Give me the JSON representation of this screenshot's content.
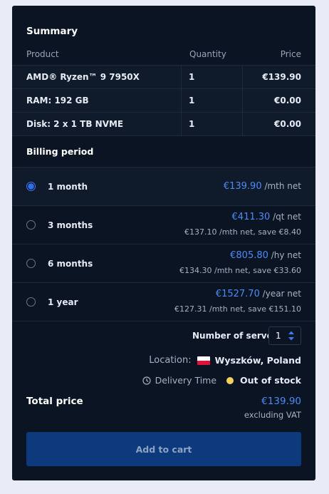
{
  "summary": {
    "title": "Summary",
    "headers": {
      "product": "Product",
      "quantity": "Quantity",
      "price": "Price"
    },
    "rows": [
      {
        "product": "AMD® Ryzen™ 9 7950X",
        "quantity": "1",
        "price": "€139.90"
      },
      {
        "product": "RAM: 192 GB",
        "quantity": "1",
        "price": "€0.00"
      },
      {
        "product": "Disk: 2 x 1 TB NVME",
        "quantity": "1",
        "price": "€0.00"
      }
    ]
  },
  "billing": {
    "title": "Billing period",
    "options": [
      {
        "label": "1 month",
        "price": "€139.90",
        "unit": "/mth net",
        "sub": "",
        "selected": true
      },
      {
        "label": "3 months",
        "price": "€411.30",
        "unit": "/qt net",
        "sub": "€137.10 /mth net, save €8.40",
        "selected": false
      },
      {
        "label": "6 months",
        "price": "€805.80",
        "unit": "/hy net",
        "sub": "€134.30 /mth net, save €33.60",
        "selected": false
      },
      {
        "label": "1 year",
        "price": "€1527.70",
        "unit": "/year net",
        "sub": "€127.31 /mth net, save €151.10",
        "selected": false
      }
    ]
  },
  "servers": {
    "label": "Number of servers",
    "value": "1"
  },
  "location": {
    "label": "Location:",
    "value": "Wyszków, Poland",
    "flag_icon": "poland-flag-icon"
  },
  "delivery": {
    "label": "Delivery Time",
    "status": "Out of stock",
    "status_color": "#f2d25c"
  },
  "total": {
    "label": "Total price",
    "price": "€139.90",
    "note": "excluding VAT"
  },
  "cart": {
    "label": "Add to cart"
  },
  "colors": {
    "accent": "#4d8bf6",
    "button": "#0d3a7c",
    "background": "#0b1423"
  }
}
